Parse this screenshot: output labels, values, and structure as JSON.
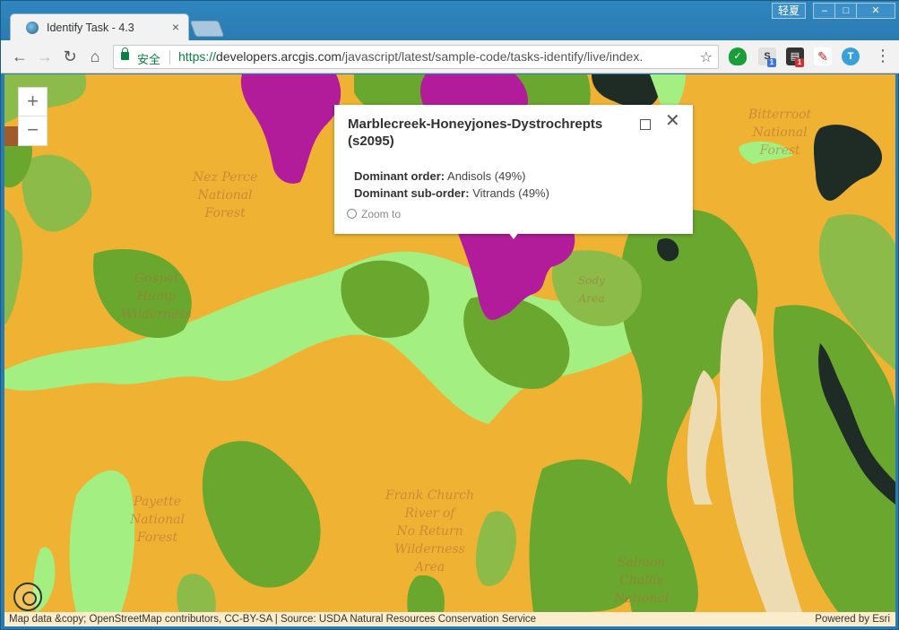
{
  "browser": {
    "tab_title": "Identify Task - 4.3",
    "tab_close": "×",
    "user_badge": "轻夏",
    "window_minimize": "–",
    "window_maximize": "□",
    "window_close": "✕",
    "secure_label": "安全",
    "url_scheme": "https://",
    "url_host": "developers.arcgis.com",
    "url_path": "/javascript/latest/sample-code/tasks-identify/live/index.",
    "back_icon": "←",
    "forward_icon": "→",
    "reload_icon": "↻",
    "home_icon": "⌂",
    "star_icon": "☆",
    "menu_icon": "⋮",
    "extensions": [
      "shield-extension",
      "s-extension",
      "notes-extension",
      "pdf-extension",
      "translate-extension"
    ],
    "ext_badges": [
      "1",
      "1"
    ]
  },
  "map": {
    "zoom_in": "+",
    "zoom_out": "−",
    "labels": [
      {
        "text": "Nez Perce\nNational\nForest"
      },
      {
        "text": "Gospel\nHump\nWilderness"
      },
      {
        "text": "Frank Church\nRiver of\nNo Return\nWilderness\nArea"
      },
      {
        "text": "Payette\nNational\nForest"
      },
      {
        "text": "Bitterroot\nNational\nForest"
      },
      {
        "text": "Salmon\nChallis\nNational"
      },
      {
        "text": "Sody\nArea"
      }
    ],
    "attribution_left": "Map data &copy; OpenStreetMap contributors, CC-BY-SA | Source: USDA Natural Resources Conservation Service",
    "attribution_right": "Powered by Esri",
    "colors": {
      "orange": "#f0b233",
      "dark_green": "#6aa72f",
      "mid_green": "#8cbb49",
      "light_green": "#a4ef81",
      "magenta": "#b21c9a",
      "black": "#1f2c26",
      "tan": "#eddcb2"
    }
  },
  "popup": {
    "title": "Marblecreek-Honeyjones-Dystrochrepts (s2095)",
    "order_label": "Dominant order:",
    "order_value": "Andisols (49%)",
    "suborder_label": "Dominant sub-order:",
    "suborder_value": "Vitrands (49%)",
    "zoom_to": "Zoom to",
    "close": "✕"
  }
}
